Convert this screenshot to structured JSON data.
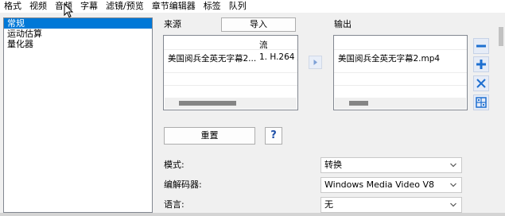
{
  "menu": {
    "items": [
      {
        "label": "格式"
      },
      {
        "label": "视频"
      },
      {
        "label": "音频"
      },
      {
        "label": "字幕"
      },
      {
        "label": "滤镜/预览"
      },
      {
        "label": "章节编辑器"
      },
      {
        "label": "标签"
      },
      {
        "label": "队列"
      }
    ]
  },
  "left_panel": {
    "items": [
      {
        "label": "常规",
        "selected": true
      },
      {
        "label": "运动估算",
        "selected": false
      },
      {
        "label": "量化器",
        "selected": false
      }
    ]
  },
  "source": {
    "heading": "来源",
    "import_label": "导入",
    "stream_header": "流",
    "file_name": "美国阅兵全英无字幕2...",
    "stream_value": "1. H.264 /"
  },
  "output": {
    "heading": "输出",
    "file_name": "美国阅兵全英无字幕2.mp4"
  },
  "actions": {
    "reset_label": "重置",
    "help_label": "?"
  },
  "form": {
    "mode_label": "模式:",
    "mode_value": "转换",
    "decoder_label": "编解码器:",
    "decoder_value": "Windows Media Video V8",
    "language_label": "语言:",
    "language_value": "无"
  },
  "colors": {
    "selection": "#0078d7",
    "side_button_blue": "#1e6fd0",
    "side_button_bg": "#e6ecf7"
  }
}
